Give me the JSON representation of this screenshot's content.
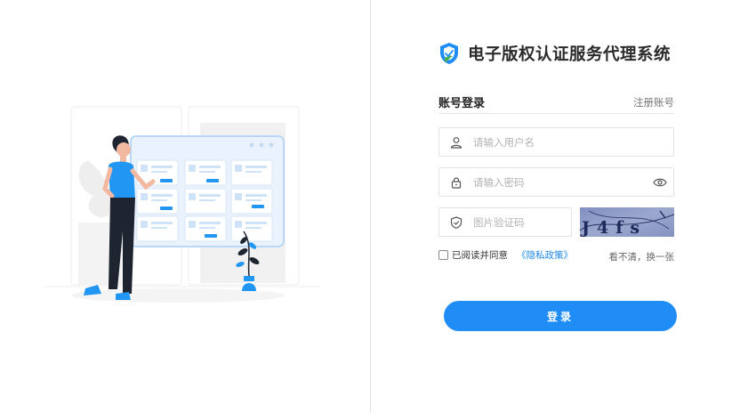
{
  "brand": {
    "title": "电子版权认证服务代理系统",
    "icon": "shield-logo-icon"
  },
  "login": {
    "tab_label": "账号登录",
    "register_link": "注册账号",
    "username": {
      "placeholder": "请输入用户名",
      "value": "",
      "icon": "user-icon"
    },
    "password": {
      "placeholder": "请输入密码",
      "value": "",
      "icon": "lock-icon",
      "toggle_icon": "eye-icon"
    },
    "captcha": {
      "placeholder": "图片验证码",
      "value": "",
      "icon": "shield-check-icon",
      "image_text": "J4fs"
    },
    "agree_prefix": "已阅读并同意",
    "policy_link": "《隐私政策》",
    "agree_checked": false,
    "refresh_link": "看不清，换一张",
    "submit_label": "登录"
  },
  "colors": {
    "accent": "#1f8df5",
    "link": "#1e88e5",
    "divider": "#e4e4e4"
  }
}
